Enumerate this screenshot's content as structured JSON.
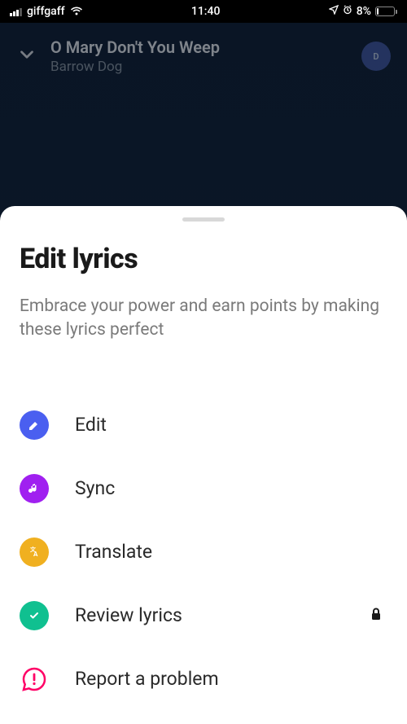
{
  "status": {
    "carrier": "giffgaff",
    "time": "11:40",
    "battery": "8%"
  },
  "player": {
    "title": "O Mary Don't You Weep",
    "artist": "Barrow Dog",
    "avatar_letter": "D"
  },
  "sheet": {
    "title": "Edit lyrics",
    "subtitle": "Embrace your power and earn points by making these lyrics perfect"
  },
  "options": {
    "edit": "Edit",
    "sync": "Sync",
    "translate": "Translate",
    "review": "Review lyrics",
    "report": "Report a problem"
  }
}
